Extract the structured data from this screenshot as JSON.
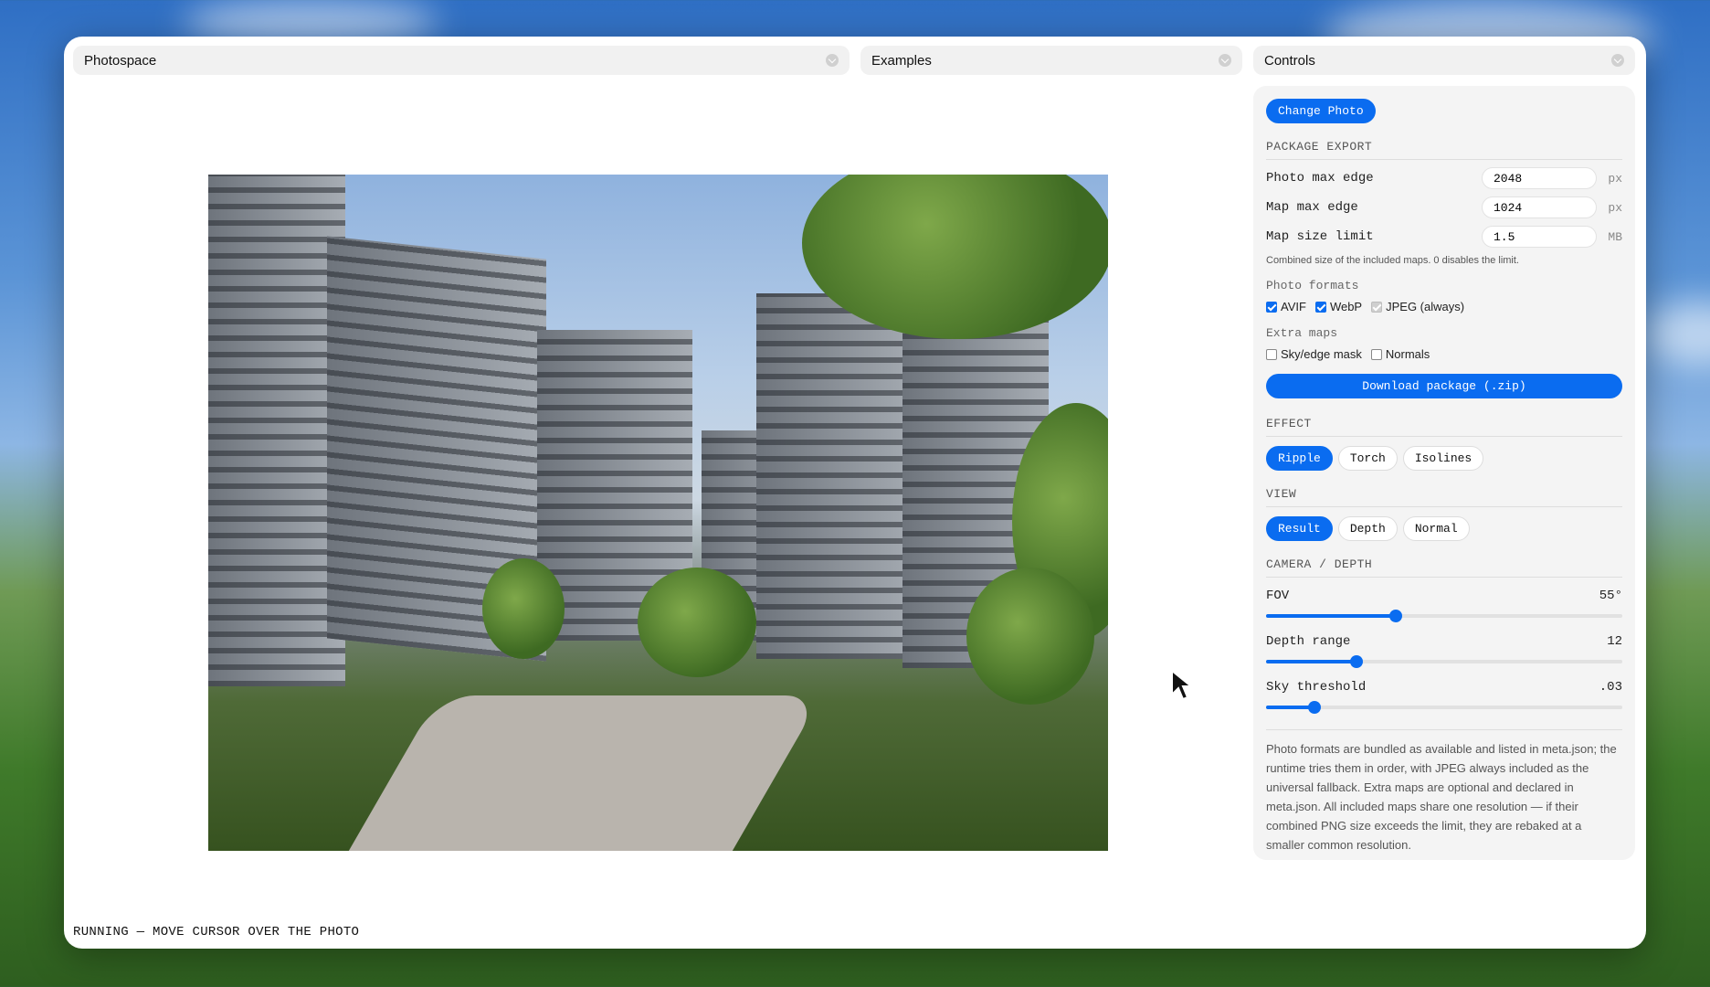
{
  "panes": {
    "photospace": {
      "title": "Photospace"
    },
    "examples": {
      "title": "Examples"
    },
    "controls": {
      "title": "Controls"
    }
  },
  "status_text": "RUNNING — MOVE CURSOR OVER THE PHOTO",
  "controls": {
    "change_photo_label": "Change Photo",
    "package_export": {
      "title": "PACKAGE EXPORT",
      "photo_max_edge": {
        "label": "Photo max edge",
        "value": "2048",
        "unit": "px"
      },
      "map_max_edge": {
        "label": "Map max edge",
        "value": "1024",
        "unit": "px"
      },
      "map_size_limit": {
        "label": "Map size limit",
        "value": "1.5",
        "unit": "MB"
      },
      "hint": "Combined size of the included maps. 0 disables the limit.",
      "photo_formats": {
        "label": "Photo formats",
        "avif": {
          "label": "AVIF",
          "checked": true
        },
        "webp": {
          "label": "WebP",
          "checked": true
        },
        "jpeg": {
          "label": "JPEG (always)",
          "checked": true,
          "disabled": true
        }
      },
      "extra_maps": {
        "label": "Extra maps",
        "sky_edge_mask": {
          "label": "Sky/edge mask",
          "checked": false
        },
        "normals": {
          "label": "Normals",
          "checked": false
        }
      },
      "download_label": "Download package (.zip)"
    },
    "effect": {
      "title": "EFFECT",
      "options": [
        "Ripple",
        "Torch",
        "Isolines"
      ],
      "selected": "Ripple"
    },
    "view": {
      "title": "VIEW",
      "options": [
        "Result",
        "Depth",
        "Normal"
      ],
      "selected": "Result"
    },
    "camera_depth": {
      "title": "CAMERA / DEPTH",
      "fov": {
        "label": "FOV",
        "display": "55°",
        "fraction": 0.365
      },
      "depth_range": {
        "label": "Depth range",
        "display": "12",
        "fraction": 0.255
      },
      "sky_threshold": {
        "label": "Sky threshold",
        "display": ".03",
        "fraction": 0.135
      }
    },
    "note": "Photo formats are bundled as available and listed in meta.json; the runtime tries them in order, with JPEG always included as the universal fallback. Extra maps are optional and declared in meta.json. All included maps share one resolution — if their combined PNG size exceeds the limit, they are rebaked at a smaller common resolution."
  },
  "colors": {
    "accent": "#0a6cf0"
  }
}
